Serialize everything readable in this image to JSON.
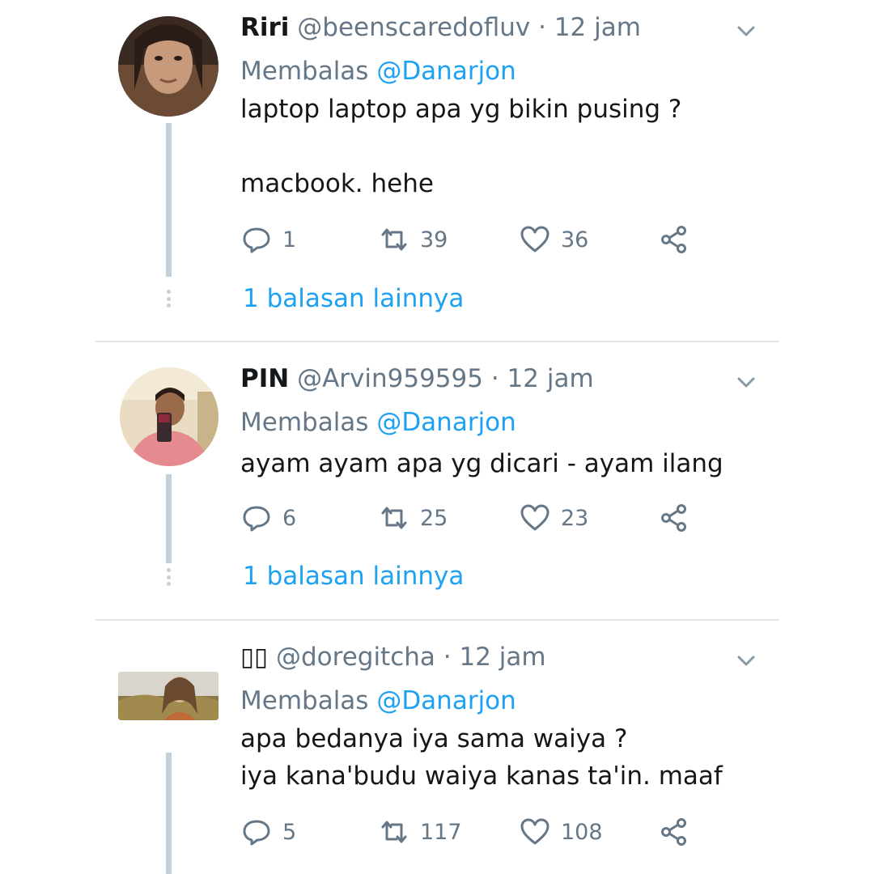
{
  "colors": {
    "link": "#1da1f2",
    "secondary_text": "#657786",
    "primary_text": "#14171a",
    "thread_line": "#c4d0da",
    "divider": "#e1e8ed"
  },
  "tweets": [
    {
      "name": "Riri",
      "handle": "@beenscaredofluv",
      "separator": "·",
      "time": "12 jam",
      "reply_prefix": "Membalas",
      "reply_to": "@Danarjon",
      "text": "laptop laptop apa yg bikin pusing ?\n\nmacbook. hehe",
      "replies": "1",
      "retweets": "39",
      "likes": "36",
      "more_replies": "1 balasan lainnya",
      "icons": [
        "chevron-down-icon",
        "reply-icon",
        "retweet-icon",
        "heart-icon",
        "share-icon"
      ]
    },
    {
      "name": "PIN",
      "handle": "@Arvin959595",
      "separator": "·",
      "time": "12 jam",
      "reply_prefix": "Membalas",
      "reply_to": "@Danarjon",
      "text": "ayam ayam apa yg dicari - ayam ilang",
      "replies": "6",
      "retweets": "25",
      "likes": "23",
      "more_replies": "1 balasan lainnya"
    },
    {
      "name": "▯▯",
      "handle": "@doregitcha",
      "separator": "·",
      "time": "12 jam",
      "reply_prefix": "Membalas",
      "reply_to": "@Danarjon",
      "text": "apa bedanya iya sama waiya ?\niya kana'budu waiya kanas ta'in. maaf",
      "replies": "5",
      "retweets": "117",
      "likes": "108"
    }
  ]
}
